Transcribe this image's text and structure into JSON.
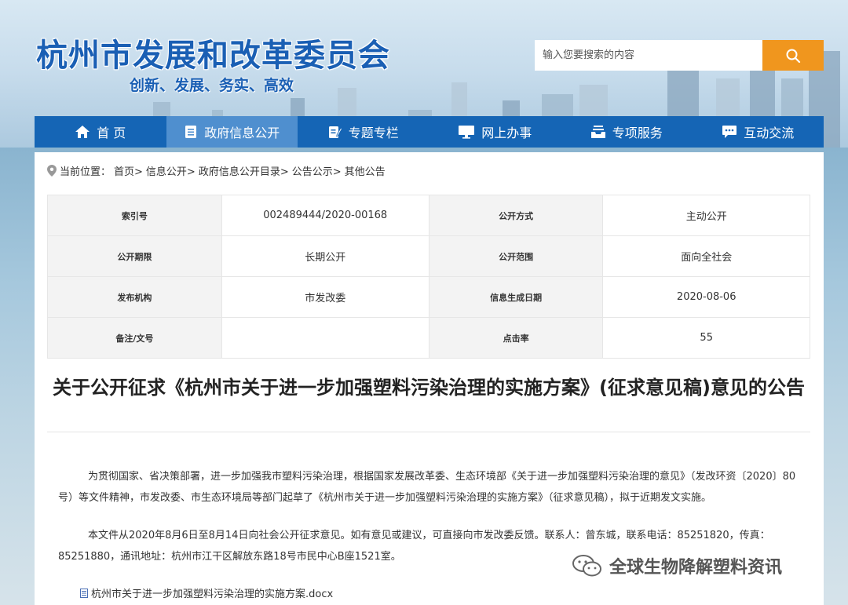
{
  "header": {
    "site_title": "杭州市发展和改革委员会",
    "slogan": "创新、发展、务实、高效",
    "search_placeholder": "输入您要搜索的内容",
    "accent_color": "#f0961e",
    "nav_color": "#1565b5"
  },
  "nav": {
    "items": [
      {
        "label": "首 页",
        "icon": "home-icon"
      },
      {
        "label": "政府信息公开",
        "icon": "document-icon",
        "active": true
      },
      {
        "label": "专题专栏",
        "icon": "edit-icon"
      },
      {
        "label": "网上办事",
        "icon": "monitor-icon"
      },
      {
        "label": "专项服务",
        "icon": "inbox-icon"
      },
      {
        "label": "互动交流",
        "icon": "chat-icon"
      }
    ]
  },
  "breadcrumb": {
    "prefix": "当前位置：",
    "items": [
      "首页>",
      "信息公开>",
      "政府信息公开目录>",
      "公告公示>",
      "其他公告"
    ]
  },
  "meta": {
    "rows": [
      [
        {
          "label": "索引号",
          "value": "002489444/2020-00168"
        },
        {
          "label": "公开方式",
          "value": "主动公开"
        }
      ],
      [
        {
          "label": "公开期限",
          "value": "长期公开"
        },
        {
          "label": "公开范围",
          "value": "面向全社会"
        }
      ],
      [
        {
          "label": "发布机构",
          "value": "市发改委"
        },
        {
          "label": "信息生成日期",
          "value": "2020-08-06"
        }
      ],
      [
        {
          "label": "备注/文号",
          "value": ""
        },
        {
          "label": "点击率",
          "value": "55"
        }
      ]
    ]
  },
  "article": {
    "title": "关于公开征求《杭州市关于进一步加强塑料污染治理的实施方案》(征求意见稿)意见的公告",
    "paragraphs": [
      "为贯彻国家、省决策部署，进一步加强我市塑料污染治理，根据国家发展改革委、生态环境部《关于进一步加强塑料污染治理的意见》（发改环资〔2020〕80号）等文件精神，市发改委、市生态环境局等部门起草了《杭州市关于进一步加强塑料污染治理的实施方案》（征求意见稿），拟于近期发文实施。",
      "本文件从2020年8月6日至8月14日向社会公开征求意见。如有意见或建议，可直接向市发改委反馈。联系人：曾东城，联系电话：85251820，传真：85251880，通讯地址：杭州市江干区解放东路18号市民中心B座1521室。"
    ],
    "attachment": "杭州市关于进一步加强塑料污染治理的实施方案.docx"
  },
  "watermark": {
    "text": "全球生物降解塑料资讯",
    "icon": "wechat-icon"
  }
}
